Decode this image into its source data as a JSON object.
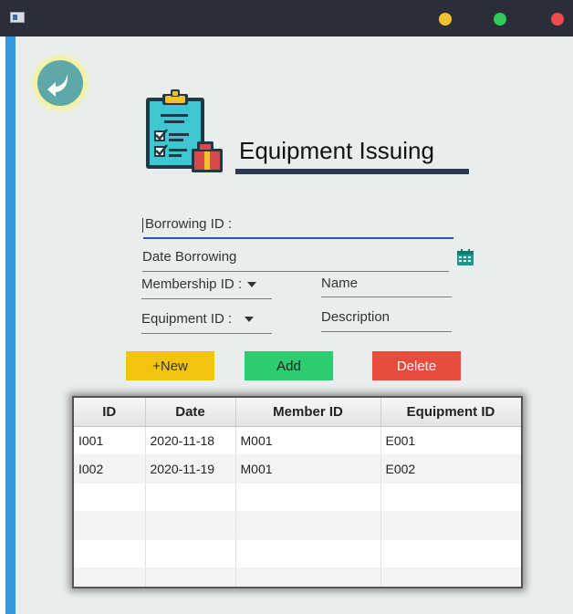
{
  "window": {
    "controls": [
      "minimize",
      "maximize",
      "close"
    ],
    "colors": {
      "titlebar": "#2b2e39",
      "minimize": "#f2c12e",
      "maximize": "#2ecc56",
      "close": "#ef4b4b"
    }
  },
  "page": {
    "title": "Equipment Issuing"
  },
  "form": {
    "borrowing_id": {
      "label": "Borrowing ID :",
      "value": ""
    },
    "date_borrowing": {
      "label": "Date Borrowing",
      "value": ""
    },
    "membership_id": {
      "label": "Membership ID :",
      "value": ""
    },
    "name": {
      "label": "Name",
      "value": ""
    },
    "equipment_id": {
      "label": "Equipment ID :",
      "value": ""
    },
    "description": {
      "label": "Description",
      "value": ""
    }
  },
  "buttons": {
    "new_label": "+New",
    "add_label": "Add",
    "delete_label": "Delete",
    "colors": {
      "new": "#f2c40f",
      "add": "#2ecc71",
      "delete": "#e74c3c"
    }
  },
  "table": {
    "columns": [
      "ID",
      "Date",
      "Member ID",
      "Equipment ID"
    ],
    "rows": [
      [
        "I001",
        "2020-11-18",
        "M001",
        "E001"
      ],
      [
        "I002",
        "2020-11-19",
        "M001",
        "E002"
      ],
      [
        "",
        "",
        "",
        ""
      ],
      [
        "",
        "",
        "",
        ""
      ],
      [
        "",
        "",
        "",
        ""
      ],
      [
        "",
        "",
        "",
        ""
      ]
    ]
  },
  "icons": [
    "app-icon",
    "back-arrow-icon",
    "clipboard-logo-icon",
    "calendar-icon",
    "dropdown-arrow-icon"
  ]
}
